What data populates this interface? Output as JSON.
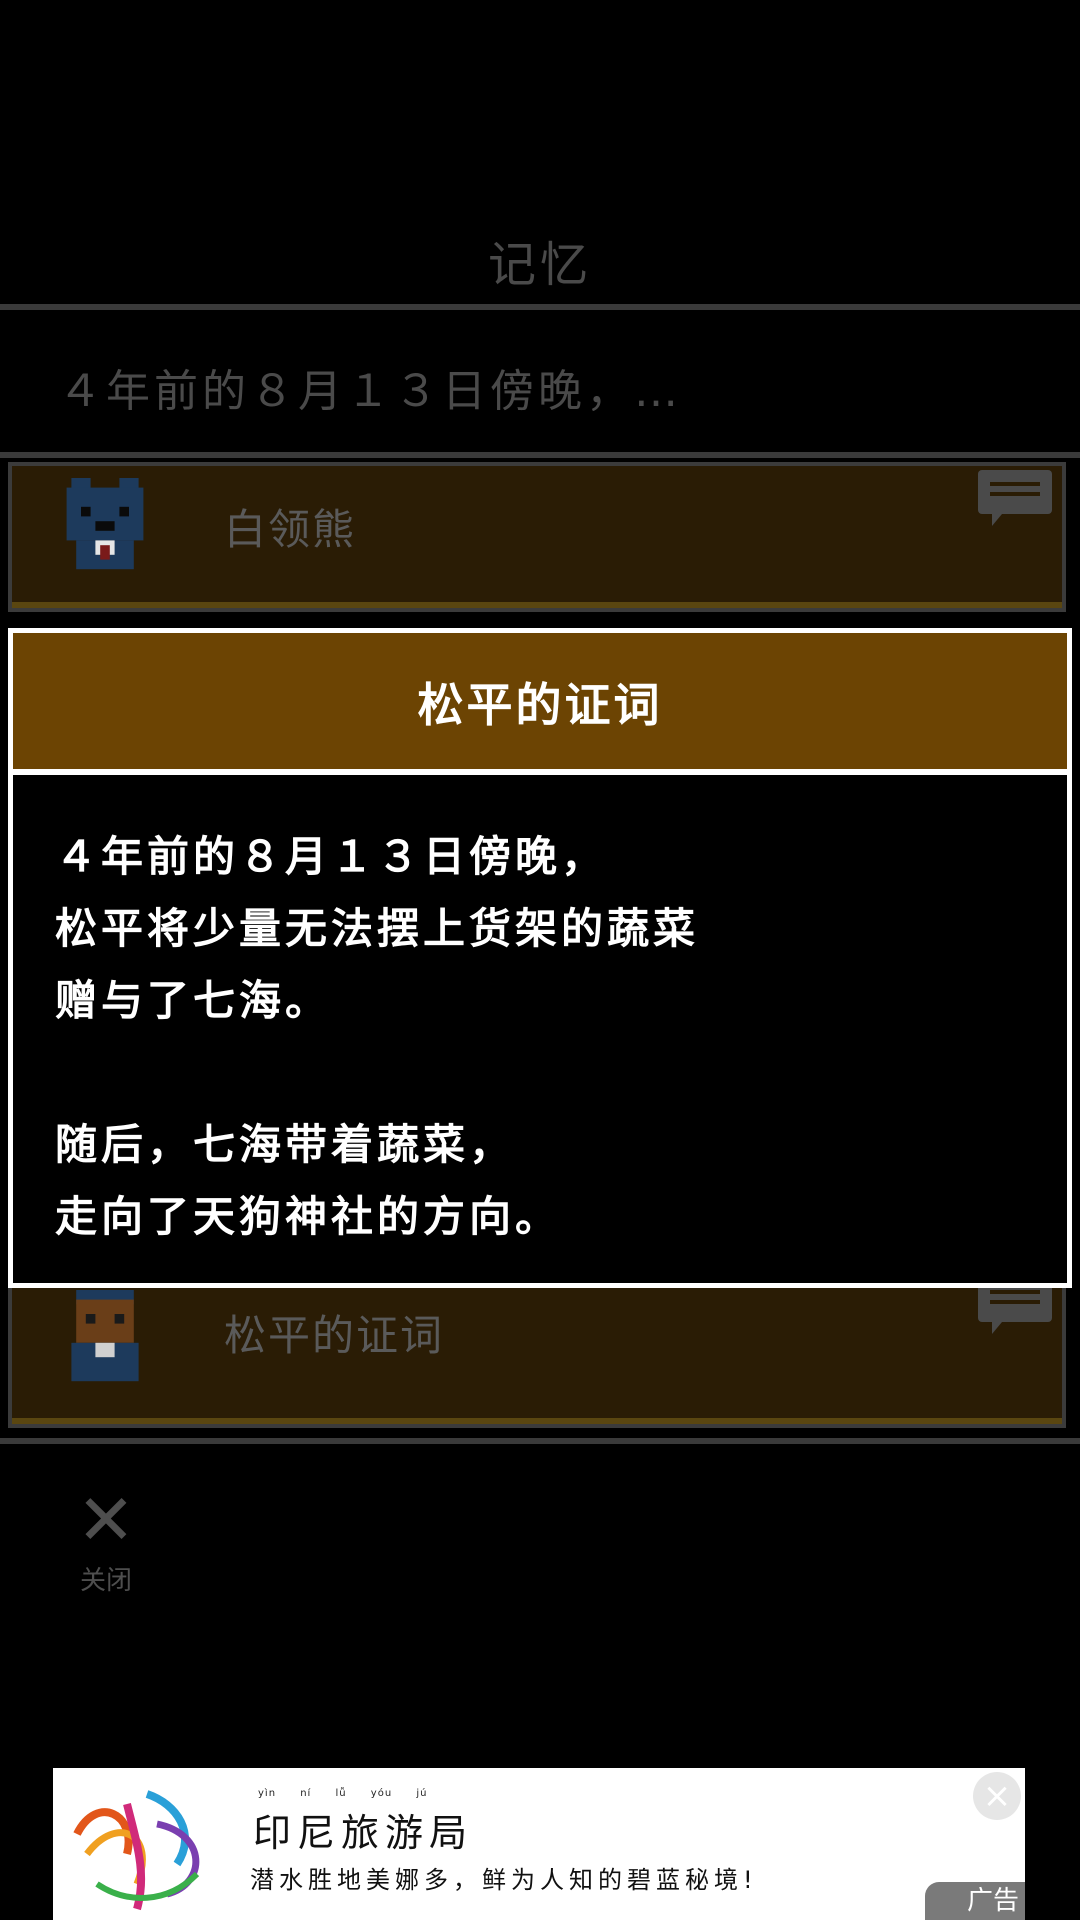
{
  "memory": {
    "title": "记忆",
    "summary": "４年前的８月１３日傍晚，…",
    "cards": [
      {
        "label": "白领熊",
        "avatar": "bear-avatar-icon"
      },
      {
        "label": "松平的证词",
        "avatar": "matsudaira-avatar-icon"
      }
    ],
    "close_label": "关闭",
    "close_icon": "close-x-icon"
  },
  "modal": {
    "title": "松平的证词",
    "paragraphs": [
      [
        "４年前的８月１３日傍晚，",
        "松平将少量无法摆上货架的蔬菜",
        "赠与了七海。"
      ],
      [
        "随后，七海带着蔬菜，",
        "走向了天狗神社的方向。"
      ]
    ]
  },
  "ad": {
    "title": "印尼旅游局",
    "title_pinyin": "yìn ní lǚ yóu jú",
    "subtitle": "潜水胜地美娜多，鲜为人知的碧蓝秘境!",
    "close_icon": "×",
    "tag": "广告"
  },
  "colors": {
    "header_brown": "#6c4403",
    "card_brown": "#2a1c05",
    "dim_text": "#4a4a4a"
  }
}
